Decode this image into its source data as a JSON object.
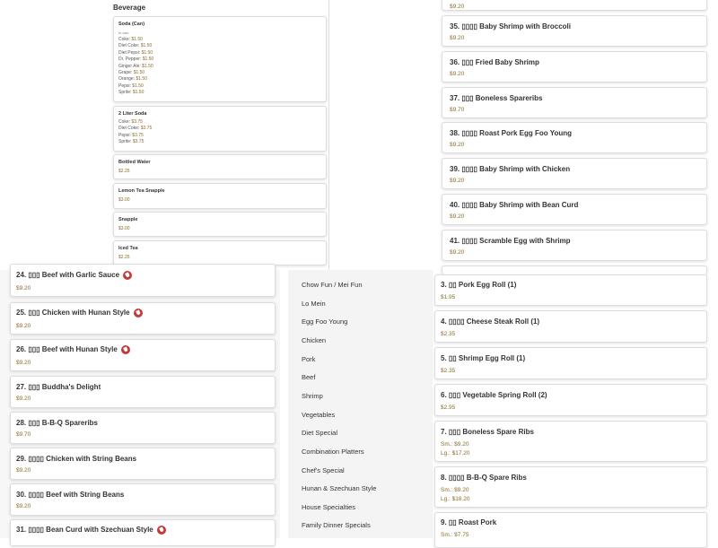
{
  "beverage": {
    "heading": "Beverage",
    "items": [
      {
        "name": "Soda (Can)",
        "note": "In can.",
        "lines": [
          [
            "Coke:",
            "$1.50"
          ],
          [
            "Diet Coke:",
            "$1.50"
          ],
          [
            "Diet Pepsi:",
            "$1.50"
          ],
          [
            "Dr. Pepper:",
            "$1.50"
          ],
          [
            "Ginger Ale:",
            "$1.50"
          ],
          [
            "Grape:",
            "$1.50"
          ],
          [
            "Orange:",
            "$1.50"
          ],
          [
            "Pepsi:",
            "$1.50"
          ],
          [
            "Sprite:",
            "$1.50"
          ]
        ]
      },
      {
        "name": "2 Liter Soda",
        "lines": [
          [
            "Coke:",
            "$3.75"
          ],
          [
            "Diet Coke:",
            "$3.75"
          ],
          [
            "Pepsi:",
            "$3.75"
          ],
          [
            "Sprite:",
            "$3.75"
          ]
        ]
      },
      {
        "name": "Bottled Water",
        "price": "$2.25"
      },
      {
        "name": "Lemon Tea Snapple",
        "price": "$3.00"
      },
      {
        "name": "Snapple",
        "price": "$3.00"
      },
      {
        "name": "Iced Tea",
        "price": "$2.25"
      }
    ]
  },
  "right_top": {
    "partial_price": "$9.20",
    "items": [
      {
        "title": "35. ▯▯▯▯ Baby Shrimp with Broccoli",
        "price": "$9.20"
      },
      {
        "title": "36. ▯▯▯ Fried Baby Shrimp",
        "price": "$9.20"
      },
      {
        "title": "37. ▯▯▯ Boneless Spareribs",
        "price": "$9.70"
      },
      {
        "title": "38. ▯▯▯▯ Roast Pork Egg Foo Young",
        "price": "$9.20"
      },
      {
        "title": "39. ▯▯▯▯ Baby Shrimp with Chicken",
        "price": "$9.20"
      },
      {
        "title": "40. ▯▯▯▯ Baby Shrimp with Bean Curd",
        "price": "$9.20"
      },
      {
        "title": "41. ▯▯▯▯ Scramble Egg with Shrimp",
        "price": "$9.20"
      }
    ]
  },
  "left_list": {
    "items": [
      {
        "title": "24. ▯▯▯ Beef with Garlic Sauce",
        "price": "$9.20",
        "hot": true
      },
      {
        "title": "25. ▯▯▯ Chicken with Hunan Style",
        "price": "$9.20",
        "hot": true
      },
      {
        "title": "26. ▯▯▯ Beef with Hunan Style",
        "price": "$9.20",
        "hot": true
      },
      {
        "title": "27. ▯▯▯ Buddha's Delight",
        "price": "$9.20",
        "hot": false
      },
      {
        "title": "28. ▯▯▯ B-B-Q Spareribs",
        "price": "$9.70",
        "hot": false
      },
      {
        "title": "29. ▯▯▯▯ Chicken with String Beans",
        "price": "$9.20",
        "hot": false
      },
      {
        "title": "30. ▯▯▯▯ Beef with String Beans",
        "price": "$9.20",
        "hot": false
      },
      {
        "title": "31. ▯▯▯▯ Bean Curd with Szechuan Style",
        "price": "",
        "hot": true
      }
    ]
  },
  "categories": [
    "Chow Fun / Mei Fun",
    "Lo Mein",
    "Egg Foo Young",
    "Chicken",
    "Pork",
    "Beef",
    "Shrimp",
    "Vegetables",
    "Diet Special",
    "Combination Platters",
    "Chef's Special",
    "Hunan & Szechuan Style",
    "House Specialties",
    "Family Dinner Specials"
  ],
  "right_bottom": {
    "items": [
      {
        "title": "3. ▯▯ Pork Egg Roll (1)",
        "prices": [
          "$1.95"
        ]
      },
      {
        "title": "4. ▯▯▯▯ Cheese Steak Roll (1)",
        "prices": [
          "$2.35"
        ]
      },
      {
        "title": "5. ▯▯ Shrimp Egg Roll (1)",
        "prices": [
          "$2.35"
        ]
      },
      {
        "title": "6. ▯▯▯ Vegetable Spring Roll (2)",
        "prices": [
          "$2.95"
        ]
      },
      {
        "title": "7. ▯▯▯ Boneless Spare Ribs",
        "prices": [
          "Sm.: $9.20",
          "Lg.: $17.20"
        ]
      },
      {
        "title": "8. ▯▯▯▯ B-B-Q Spare Ribs",
        "prices": [
          "Sm.: $9.20",
          "Lg.: $18.20"
        ]
      },
      {
        "title": "9. ▯▯ Roast Pork",
        "prices": [
          "Sm.: $7.75"
        ]
      }
    ]
  }
}
